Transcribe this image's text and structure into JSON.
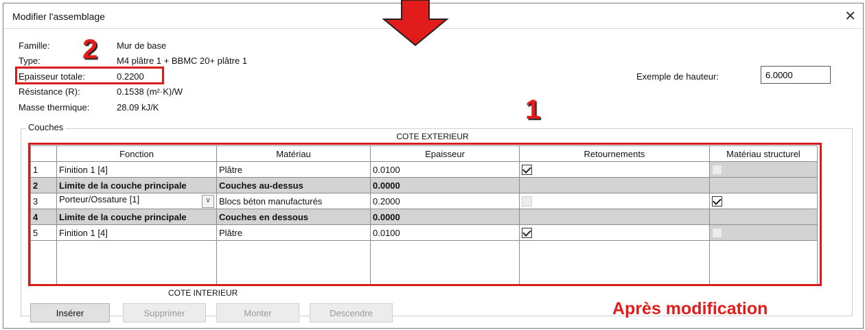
{
  "dialog": {
    "title": "Modifier l'assemblage",
    "close": "✕"
  },
  "info": {
    "famille_label": "Famille:",
    "famille_value": "Mur de base",
    "type_label": "Type:",
    "type_value": "M4 plâtre 1 + BBMC 20+ plâtre 1",
    "epaisseur_label": "Epaisseur totale:",
    "epaisseur_value": "0.2200",
    "resistance_label": "Résistance (R):",
    "resistance_value": "0.1538 (m²·K)/W",
    "masse_label": "Masse thermique:",
    "masse_value": "28.09 kJ/K"
  },
  "height": {
    "label": "Exemple de hauteur:",
    "value": "6.0000"
  },
  "couches": {
    "group_label": "Couches",
    "exterior": "COTE EXTERIEUR",
    "interior": "COTE INTERIEUR",
    "columns": [
      "",
      "Fonction",
      "Matériau",
      "Epaisseur",
      "Retournements",
      "Matériau structurel"
    ],
    "rows": [
      {
        "n": "1",
        "fonction": "Finition 1 [4]",
        "materiau": "Plâtre",
        "epaisseur": "0.0100"
      },
      {
        "n": "2",
        "fonction": "Limite de la couche principale",
        "materiau": "Couches au-dessus",
        "epaisseur": "0.0000"
      },
      {
        "n": "3",
        "fonction": "Porteur/Ossature [1]",
        "materiau": "Blocs béton manufacturés",
        "epaisseur": "0.2000"
      },
      {
        "n": "4",
        "fonction": "Limite de la couche principale",
        "materiau": "Couches en dessous",
        "epaisseur": "0.0000"
      },
      {
        "n": "5",
        "fonction": "Finition 1 [4]",
        "materiau": "Plâtre",
        "epaisseur": "0.0100"
      }
    ],
    "dropdown_icon": "chevron-down-icon"
  },
  "buttons": {
    "inserer": "Insérer",
    "supprimer": "Supprimer",
    "monter": "Monter",
    "descendre": "Descendre"
  },
  "annotations": {
    "badge1": "1",
    "badge2": "2",
    "apres": "Après modification",
    "color": "#e21b1b"
  }
}
